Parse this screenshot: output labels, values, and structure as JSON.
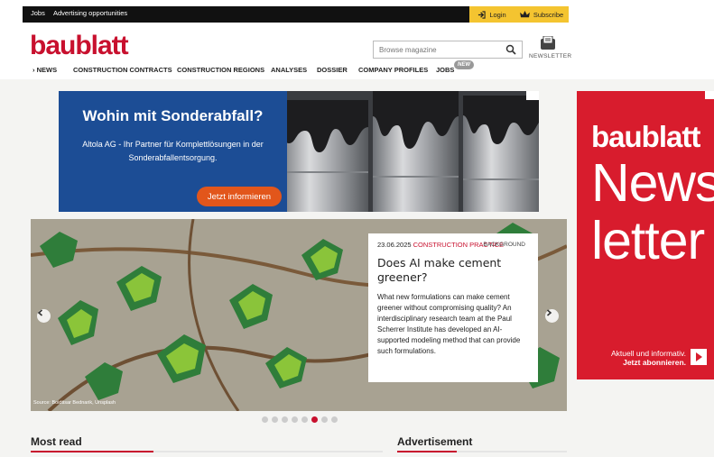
{
  "topbar": {
    "jobs": "Jobs",
    "advertising": "Advertising opportunities",
    "login": "Login",
    "subscribe": "Subscribe"
  },
  "header": {
    "logo": "baublatt",
    "search_placeholder": "Browse magazine",
    "newsletter": "NEWSLETTER"
  },
  "nav": {
    "items": [
      "› NEWS",
      "CONSTRUCTION CONTRACTS",
      "CONSTRUCTION REGIONS",
      "ANALYSES",
      "DOSSIER",
      "COMPANY PROFILES",
      "JOBS"
    ],
    "new_badge": "NEW"
  },
  "ad": {
    "title": "Wohin mit Sonderabfall?",
    "text": "Altola AG - Ihr Partner für Komplettlösungen in der Sonderabfallentsorgung.",
    "cta": "Jetzt informieren"
  },
  "side_ad": {
    "logo": "baublatt",
    "line1": "News",
    "line2": "letter",
    "small1": "Aktuell und informativ.",
    "small2": "Jetzt abonnieren."
  },
  "hero": {
    "source": "Source: Boidtisar Bednarik, Unsplash",
    "date": "23.06.2025",
    "category": "CONSTRUCTION PRACTICE",
    "type": "BACKGROUND",
    "title": "Does AI make cement greener?",
    "text": "What new formulations can make cement greener without compromising quality? An interdisciplinary research team at the Paul Scherrer Institute has developed an AI-supported modeling method that can provide such formulations.",
    "dots_total": 8,
    "dots_active_index": 5
  },
  "sections": {
    "most_read": "Most read",
    "advertisement": "Advertisement"
  },
  "colors": {
    "brand_red": "#c8102e",
    "accent_yellow": "#f4c430",
    "ad_blue": "#1c4d95",
    "cta_orange": "#e2561b"
  }
}
